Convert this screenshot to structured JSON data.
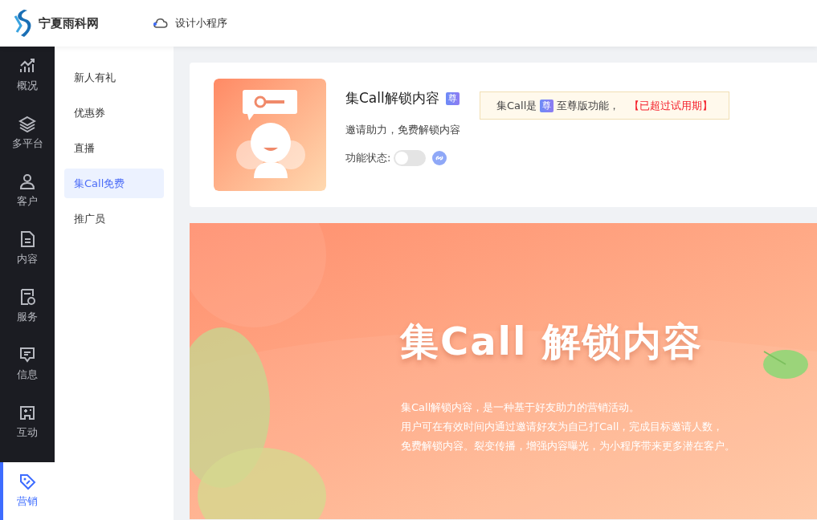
{
  "header": {
    "logo_text": "宁夏雨科网",
    "design_link": "设计小程序"
  },
  "rail": [
    {
      "label": "概况",
      "selected": false
    },
    {
      "label": "多平台",
      "selected": false
    },
    {
      "label": "客户",
      "selected": false
    },
    {
      "label": "内容",
      "selected": false
    },
    {
      "label": "服务",
      "selected": false
    },
    {
      "label": "信息",
      "selected": false
    },
    {
      "label": "互动",
      "selected": false
    },
    {
      "label": "营销",
      "selected": true
    }
  ],
  "submenu": [
    {
      "label": "新人有礼",
      "selected": false
    },
    {
      "label": "优惠券",
      "selected": false
    },
    {
      "label": "直播",
      "selected": false
    },
    {
      "label": "集Call免费",
      "selected": true
    },
    {
      "label": "推广员",
      "selected": false
    }
  ],
  "feature": {
    "title": "集Call解锁内容",
    "badge": "尊",
    "subtitle": "邀请助力，免费解锁内容",
    "status_label": "功能状态:",
    "status_on": false,
    "notice": {
      "prefix": "集Call是",
      "badge": "尊",
      "middle": "至尊版功能，",
      "warning": "【已超过试用期】"
    }
  },
  "banner": {
    "title": "集Call 解锁内容",
    "lines": [
      "集Call解锁内容，是一种基于好友助力的营销活动。",
      "用户可在有效时间内通过邀请好友为自己打Call，完成目标邀请人数，",
      "免费解锁内容。裂变传播，增强内容曝光，为小程序带来更多潜在客户。"
    ]
  }
}
